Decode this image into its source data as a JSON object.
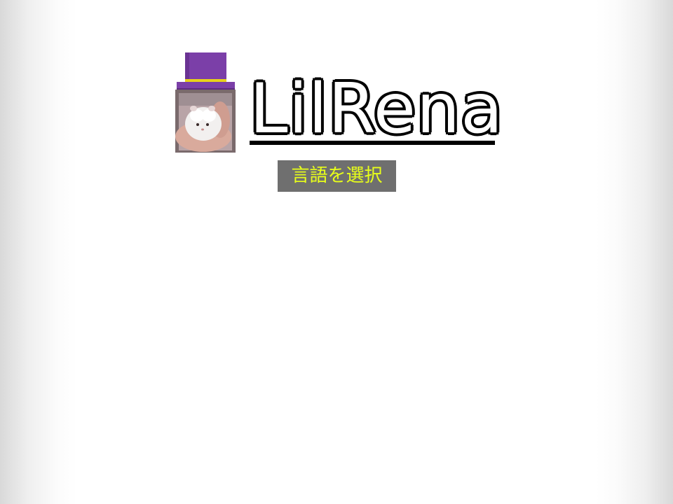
{
  "site": {
    "title": "LilRena",
    "logo_icon": "hamster-top-hat-icon"
  },
  "language_button": {
    "label": "言語を選択"
  },
  "colors": {
    "hat_purple": "#7b3fa8",
    "hat_band": "#e8d21a",
    "button_bg": "#6f6f6f",
    "button_text": "#e8ff1a",
    "title_fill": "#ffffff",
    "title_outline": "#000000"
  }
}
